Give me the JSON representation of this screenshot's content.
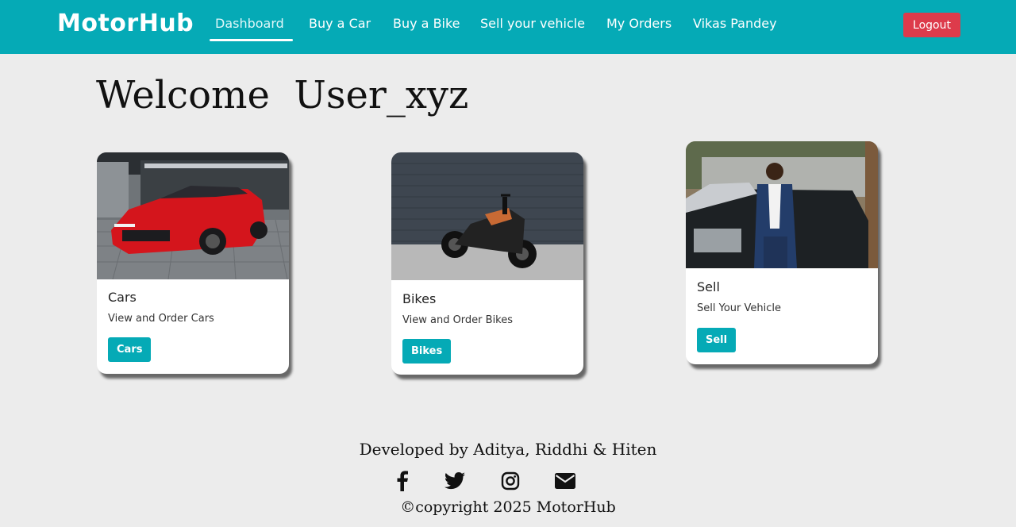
{
  "brand": "MotorHub",
  "nav": {
    "items": [
      {
        "label": "Dashboard",
        "active": true
      },
      {
        "label": "Buy a Car"
      },
      {
        "label": "Buy a Bike"
      },
      {
        "label": "Sell your vehicle"
      },
      {
        "label": "My Orders"
      },
      {
        "label": "Vikas Pandey"
      }
    ],
    "logout_label": "Logout"
  },
  "welcome": {
    "text": "Welcome  User_xyz"
  },
  "cards": [
    {
      "title": "Cars",
      "description": "View and Order Cars",
      "button_label": "Cars",
      "image": "red-sports-car"
    },
    {
      "title": "Bikes",
      "description": "View and Order Bikes",
      "button_label": "Bikes",
      "image": "electric-motorcycle"
    },
    {
      "title": "Sell",
      "description": "Sell Your Vehicle",
      "button_label": "Sell",
      "image": "man-with-car"
    }
  ],
  "footer": {
    "developed_by": "Developed by Aditya, Riddhi & Hiten",
    "social_icons": [
      "facebook-icon",
      "twitter-icon",
      "instagram-icon",
      "email-icon"
    ],
    "copyright": "©copyright 2025 MotorHub"
  },
  "colors": {
    "navbar": "#05aab6",
    "button": "#05aab6",
    "logout": "#dd3b4b",
    "background": "#ececec"
  }
}
